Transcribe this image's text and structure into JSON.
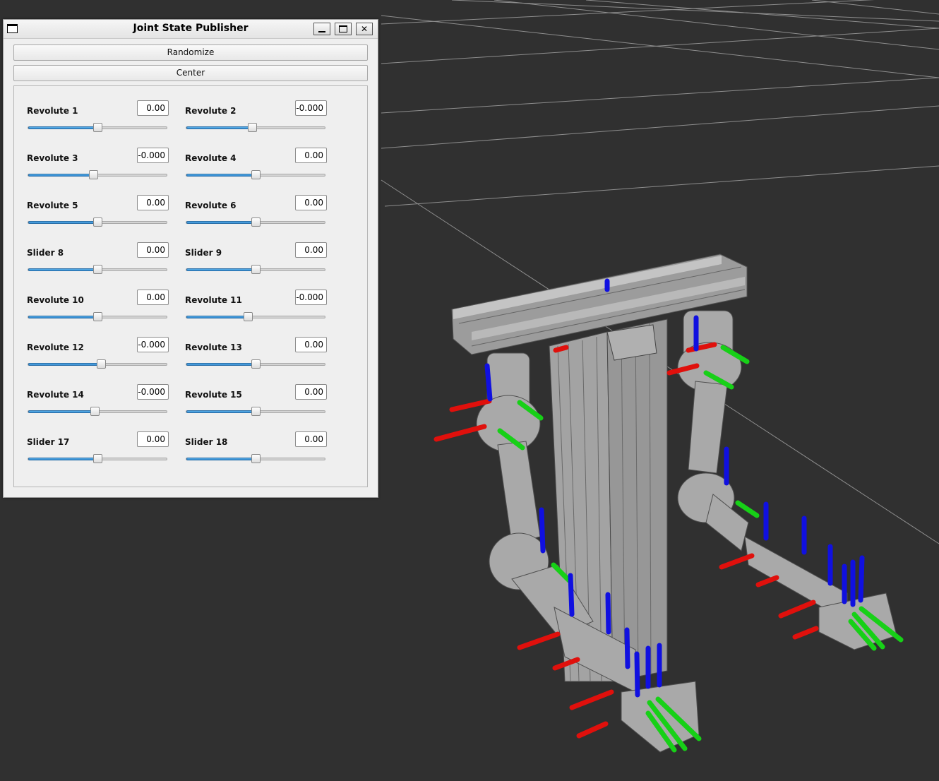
{
  "window": {
    "title": "Joint State Publisher",
    "randomize_label": "Randomize",
    "center_label": "Center"
  },
  "joints": [
    {
      "label": "Revolute 1",
      "value": "0.00",
      "position": 0.5
    },
    {
      "label": "Revolute 2",
      "value": "-0.000",
      "position": 0.475
    },
    {
      "label": "Revolute 3",
      "value": "-0.000",
      "position": 0.47
    },
    {
      "label": "Revolute 4",
      "value": "0.00",
      "position": 0.5
    },
    {
      "label": "Revolute 5",
      "value": "0.00",
      "position": 0.5
    },
    {
      "label": "Revolute 6",
      "value": "0.00",
      "position": 0.5
    },
    {
      "label": "Slider 8",
      "value": "0.00",
      "position": 0.5
    },
    {
      "label": "Slider 9",
      "value": "0.00",
      "position": 0.5
    },
    {
      "label": "Revolute 10",
      "value": "0.00",
      "position": 0.5
    },
    {
      "label": "Revolute 11",
      "value": "-0.000",
      "position": 0.445
    },
    {
      "label": "Revolute 12",
      "value": "-0.000",
      "position": 0.525
    },
    {
      "label": "Revolute 13",
      "value": "0.00",
      "position": 0.5
    },
    {
      "label": "Revolute 14",
      "value": "-0.000",
      "position": 0.48
    },
    {
      "label": "Revolute 15",
      "value": "0.00",
      "position": 0.5
    },
    {
      "label": "Slider 17",
      "value": "0.00",
      "position": 0.5
    },
    {
      "label": "Slider 18",
      "value": "0.00",
      "position": 0.5
    }
  ],
  "colors": {
    "background": "#303030",
    "grid": "#8a8a8a",
    "axis_x": "#e0100c",
    "axis_y": "#17d017",
    "axis_z": "#1010e0",
    "metal": "#a8a8a8",
    "slider_fill": "#3792d8"
  }
}
